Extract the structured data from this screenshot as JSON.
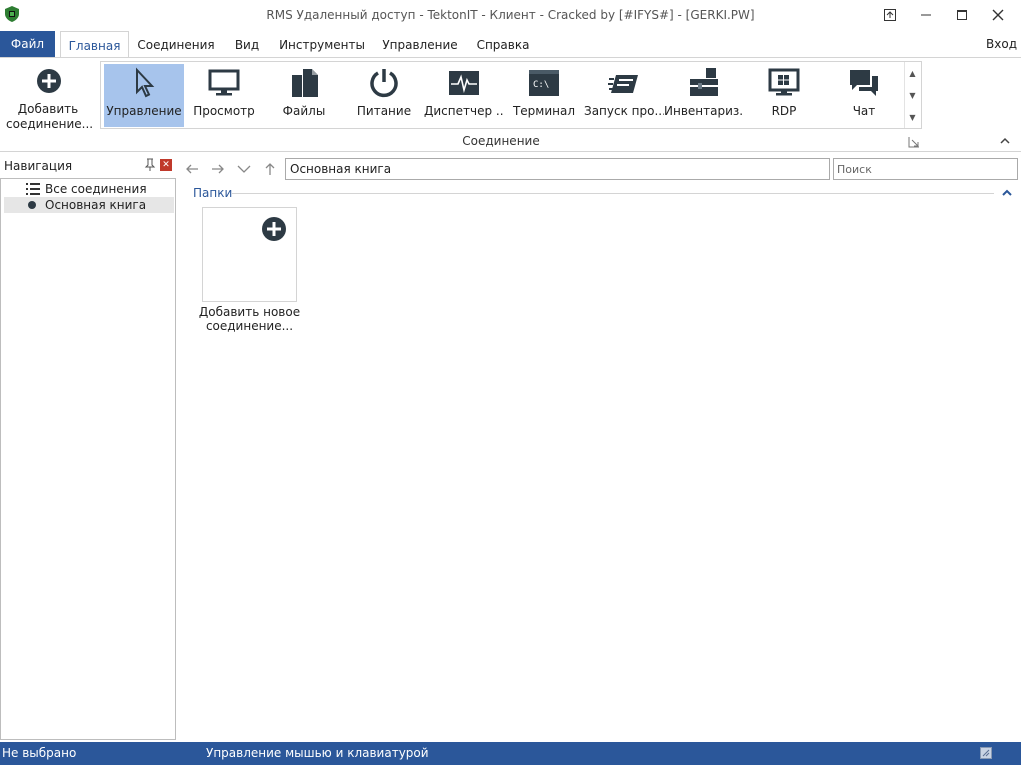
{
  "window": {
    "title": "RMS Удаленный доступ - TektonIT - Клиент - Cracked by [#IFYS#] - [GERKI.PW]"
  },
  "menu": {
    "file": "Файл",
    "tabs": [
      "Главная",
      "Соединения",
      "Вид",
      "Инструменты",
      "Управление",
      "Справка"
    ],
    "login": "Вход"
  },
  "ribbon": {
    "add_connection_label": "Добавить соединение...",
    "group_label": "Соединение",
    "gallery": [
      {
        "label": "Управление",
        "icon": "cursor-icon"
      },
      {
        "label": "Просмотр",
        "icon": "monitor-icon"
      },
      {
        "label": "Файлы",
        "icon": "files-icon"
      },
      {
        "label": "Питание",
        "icon": "power-icon"
      },
      {
        "label": "Диспетчер ...",
        "icon": "pulse-icon"
      },
      {
        "label": "Терминал",
        "icon": "terminal-icon",
        "glyph": "C:\\"
      },
      {
        "label": "Запуск про...",
        "icon": "run-icon"
      },
      {
        "label": "Инвентариз...",
        "icon": "toolbox-icon"
      },
      {
        "label": "RDP",
        "icon": "rdp-icon"
      },
      {
        "label": "Чат",
        "icon": "chat-icon"
      }
    ]
  },
  "navigation": {
    "title": "Навигация",
    "items": [
      {
        "label": "Все соединения",
        "icon": "list-icon"
      },
      {
        "label": "Основная книга",
        "icon": "bullet-icon",
        "selected": true
      }
    ]
  },
  "address": {
    "value": "Основная книга",
    "search_placeholder": "Поиск"
  },
  "content": {
    "section_title": "Папки",
    "tile_label": "Добавить новое соединение..."
  },
  "status": {
    "left": "Не выбрано",
    "mode": "Управление мышью и клавиатурой"
  },
  "colors": {
    "accent": "#2b579a",
    "selected": "#a7c4ec",
    "close_red": "#c0392b"
  }
}
